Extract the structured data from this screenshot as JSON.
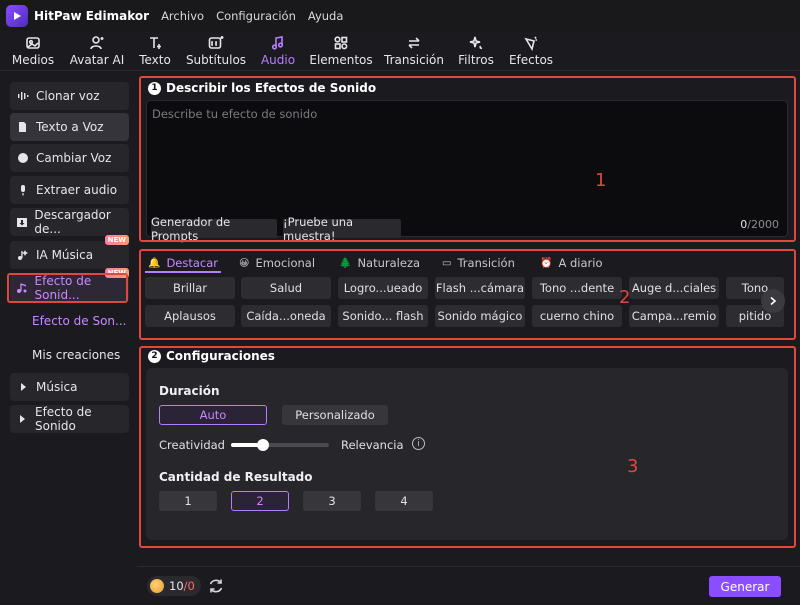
{
  "app": {
    "name": "HitPaw Edimakor",
    "menu": [
      "Archivo",
      "Configuración",
      "Ayuda"
    ]
  },
  "toolbar": {
    "tabs": [
      {
        "label": "Medios",
        "icon": "media-icon"
      },
      {
        "label": "Avatar AI",
        "icon": "avatar-icon"
      },
      {
        "label": "Texto",
        "icon": "text-icon"
      },
      {
        "label": "Subtítulos",
        "icon": "subtitles-icon"
      },
      {
        "label": "Audio",
        "icon": "audio-icon"
      },
      {
        "label": "Elementos",
        "icon": "elements-icon"
      },
      {
        "label": "Transición",
        "icon": "transition-icon"
      },
      {
        "label": "Filtros",
        "icon": "filters-icon"
      },
      {
        "label": "Efectos",
        "icon": "effects-icon"
      }
    ],
    "active": "Audio",
    "active_color": "#b77dff"
  },
  "sidebar": {
    "items": [
      {
        "label": "Clonar voz",
        "icon": "waveform-icon"
      },
      {
        "label": "Texto a Voz",
        "icon": "document-voice-icon"
      },
      {
        "label": "Cambiar Voz",
        "icon": "voice-change-icon"
      },
      {
        "label": "Extraer audio",
        "icon": "microphone-icon"
      },
      {
        "label": "Descargador de...",
        "icon": "download-icon"
      },
      {
        "label": "IA Música",
        "icon": "music-ai-icon",
        "badge": "NEW"
      },
      {
        "label": "Efecto de Sonid...",
        "icon": "sound-effect-icon",
        "badge": "NEW"
      }
    ],
    "sub_items": [
      "Efecto de Son...",
      "Mis creaciones"
    ],
    "groups": [
      "Música",
      "Efecto de Sonido"
    ]
  },
  "describe": {
    "step": "1",
    "title": "Describir los Efectos de Sonido",
    "placeholder": "Describe tu efecto de sonido",
    "prompt_button": "Generador de Prompts",
    "sample_button": "¡Pruebe una muestra!",
    "count_current": "0",
    "count_max": "/2000",
    "annotation": "1"
  },
  "categories": {
    "tabs": [
      {
        "label": "Destacar",
        "icon": "🔔"
      },
      {
        "label": "Emocional",
        "icon": "😀"
      },
      {
        "label": "Naturaleza",
        "icon": "🌲"
      },
      {
        "label": "Transición",
        "icon": "▭"
      },
      {
        "label": "A diario",
        "icon": "⏰"
      }
    ],
    "active": "Destacar",
    "chips_row1": [
      "Brillar",
      "Salud",
      "Logro...ueado",
      "Flash ...cámara",
      "Tono ...dente",
      "Auge d...ciales",
      "Tono"
    ],
    "chips_row2": [
      "Aplausos",
      "Caída...oneda",
      "Sonido... flash",
      "Sonido mágico",
      "cuerno chino",
      "Campa...remio",
      "pitido"
    ],
    "annotation": "2"
  },
  "settings": {
    "step": "2",
    "title": "Configuraciones",
    "duration_label": "Duración",
    "duration_options": [
      "Auto",
      "Personalizado"
    ],
    "duration_selected": "Auto",
    "creativity_label": "Creatividad",
    "relevance_label": "Relevancia",
    "info_glyph": "i",
    "slider_value": 0.33,
    "results_label": "Cantidad de Resultado",
    "results_options": [
      "1",
      "2",
      "3",
      "4"
    ],
    "results_selected": "2",
    "annotation": "3"
  },
  "footer": {
    "credits_used": "10",
    "credits_sep": "/",
    "credits_total": "0",
    "generate_label": "Generar",
    "generate_color": "#8a4dff"
  },
  "highlight_color": "#e0483f"
}
